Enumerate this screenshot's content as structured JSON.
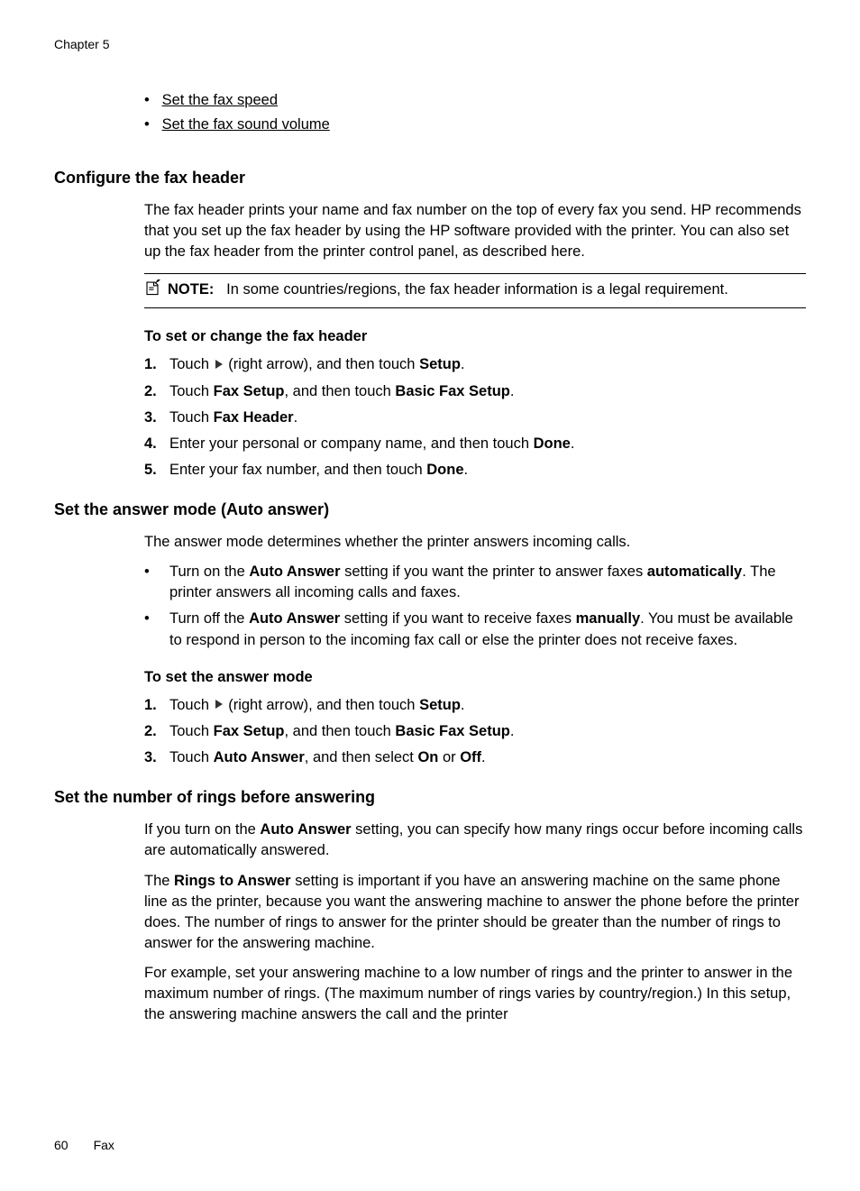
{
  "chapter": "Chapter 5",
  "topLinks": [
    "Set the fax speed",
    "Set the fax sound volume"
  ],
  "section1": {
    "heading": "Configure the fax header",
    "intro": "The fax header prints your name and fax number on the top of every fax you send. HP recommends that you set up the fax header by using the HP software provided with the printer. You can also set up the fax header from the printer control panel, as described here.",
    "noteLabel": "NOTE:",
    "noteText": "In some countries/regions, the fax header information is a legal requirement.",
    "procHeading": "To set or change the fax header",
    "steps": {
      "s1": {
        "num": "1.",
        "pre": "Touch ",
        "post": " (right arrow), and then touch ",
        "bold": "Setup",
        "end": "."
      },
      "s2": {
        "num": "2.",
        "pre": "Touch ",
        "b1": "Fax Setup",
        "mid": ", and then touch ",
        "b2": "Basic Fax Setup",
        "end": "."
      },
      "s3": {
        "num": "3.",
        "pre": "Touch ",
        "b1": "Fax Header",
        "end": "."
      },
      "s4": {
        "num": "4.",
        "pre": "Enter your personal or company name, and then touch ",
        "b1": "Done",
        "end": "."
      },
      "s5": {
        "num": "5.",
        "pre": "Enter your fax number, and then touch ",
        "b1": "Done",
        "end": "."
      }
    }
  },
  "section2": {
    "heading": "Set the answer mode (Auto answer)",
    "intro": "The answer mode determines whether the printer answers incoming calls.",
    "bullets": {
      "b1": {
        "pre": "Turn on the ",
        "bold1": "Auto Answer",
        "mid1": " setting if you want the printer to answer faxes ",
        "bold2": "automatically",
        "end": ". The printer answers all incoming calls and faxes."
      },
      "b2": {
        "pre": "Turn off the ",
        "bold1": "Auto Answer",
        "mid1": " setting if you want to receive faxes ",
        "bold2": "manually",
        "end": ". You must be available to respond in person to the incoming fax call or else the printer does not receive faxes."
      }
    },
    "procHeading": "To set the answer mode",
    "steps": {
      "s1": {
        "num": "1.",
        "pre": "Touch ",
        "post": " (right arrow), and then touch ",
        "bold": "Setup",
        "end": "."
      },
      "s2": {
        "num": "2.",
        "pre": "Touch ",
        "b1": "Fax Setup",
        "mid": ", and then touch ",
        "b2": "Basic Fax Setup",
        "end": "."
      },
      "s3": {
        "num": "3.",
        "pre": "Touch ",
        "b1": "Auto Answer",
        "mid": ", and then select ",
        "b2": "On",
        "mid2": " or ",
        "b3": "Off",
        "end": "."
      }
    }
  },
  "section3": {
    "heading": "Set the number of rings before answering",
    "p1": {
      "pre": "If you turn on the ",
      "bold": "Auto Answer",
      "post": " setting, you can specify how many rings occur before incoming calls are automatically answered."
    },
    "p2": {
      "pre": "The ",
      "bold": "Rings to Answer",
      "post": " setting is important if you have an answering machine on the same phone line as the printer, because you want the answering machine to answer the phone before the printer does. The number of rings to answer for the printer should be greater than the number of rings to answer for the answering machine."
    },
    "p3": "For example, set your answering machine to a low number of rings and the printer to answer in the maximum number of rings. (The maximum number of rings varies by country/region.) In this setup, the answering machine answers the call and the printer"
  },
  "footer": {
    "pageNum": "60",
    "section": "Fax"
  }
}
